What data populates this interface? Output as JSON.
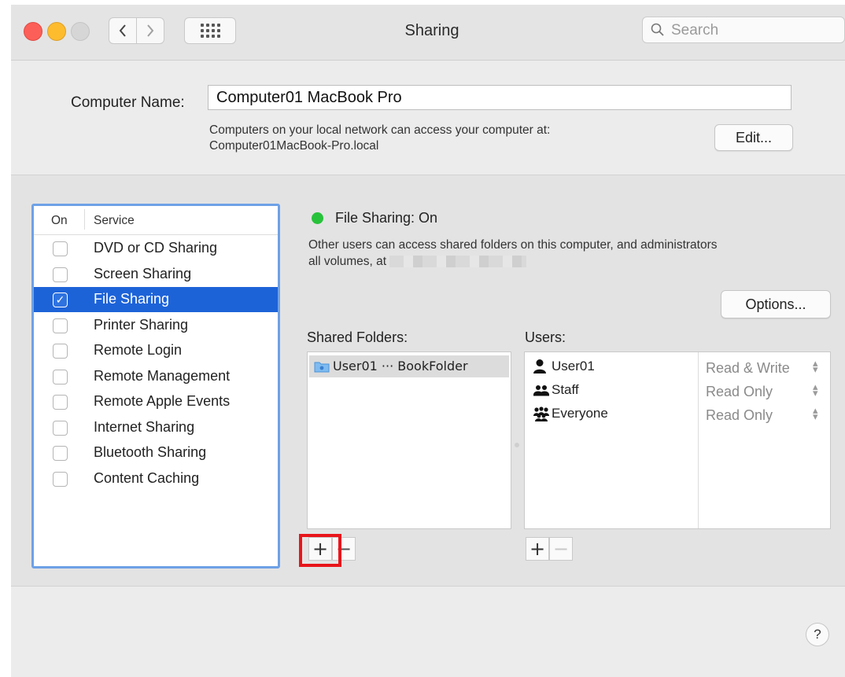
{
  "window": {
    "title": "Sharing",
    "search_placeholder": "Search"
  },
  "computer_name": {
    "label": "Computer Name:",
    "value": "Computer01 MacBook Pro",
    "info_line1": "Computers on your local network can access your computer at:",
    "info_line2": "Computer01MacBook-Pro.local",
    "edit_label": "Edit..."
  },
  "services": {
    "header_on": "On",
    "header_service": "Service",
    "items": [
      {
        "label": "DVD or CD Sharing",
        "checked": false,
        "selected": false
      },
      {
        "label": "Screen Sharing",
        "checked": false,
        "selected": false
      },
      {
        "label": "File Sharing",
        "checked": true,
        "selected": true
      },
      {
        "label": "Printer Sharing",
        "checked": false,
        "selected": false
      },
      {
        "label": "Remote Login",
        "checked": false,
        "selected": false
      },
      {
        "label": "Remote Management",
        "checked": false,
        "selected": false
      },
      {
        "label": "Remote Apple Events",
        "checked": false,
        "selected": false
      },
      {
        "label": "Internet Sharing",
        "checked": false,
        "selected": false
      },
      {
        "label": "Bluetooth Sharing",
        "checked": false,
        "selected": false
      },
      {
        "label": "Content Caching",
        "checked": false,
        "selected": false
      }
    ]
  },
  "detail": {
    "status": "File Sharing: On",
    "status_color": "#27c23a",
    "description_line1": "Other users can access shared folders on this computer, and administrators",
    "description_line2": "all volumes, at",
    "options_label": "Options...",
    "shared_folders_label": "Shared Folders:",
    "users_label": "Users:",
    "folders": [
      {
        "name": "User01 ··· BookFolder",
        "icon": "folder-icon"
      }
    ],
    "users": [
      {
        "name": "User01",
        "permission": "Read & Write",
        "icon": "user-icon"
      },
      {
        "name": "Staff",
        "permission": "Read Only",
        "icon": "group-icon"
      },
      {
        "name": "Everyone",
        "permission": "Read Only",
        "icon": "everyone-icon"
      }
    ],
    "add_symbol": "+",
    "remove_symbol": "−"
  },
  "help_label": "?",
  "colors": {
    "selection": "#1d63d8",
    "focus_ring": "#6ea1e6",
    "highlight": "#e8151b"
  }
}
